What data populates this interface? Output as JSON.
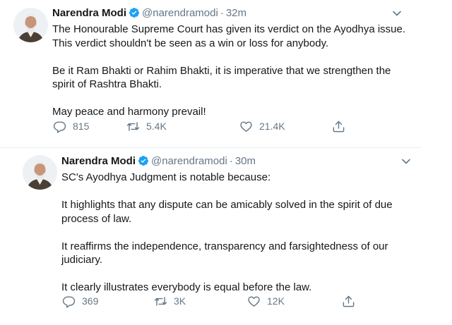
{
  "tweets": [
    {
      "author_name": "Narendra Modi",
      "handle": "@narendramodi",
      "separator": "·",
      "time": "32m",
      "paragraphs": [
        "The Honourable Supreme Court has given its verdict on the Ayodhya issue.\nThis verdict shouldn't be seen as a win or loss for anybody.",
        "Be it Ram Bhakti or Rahim Bhakti, it is imperative that we strengthen the\nspirit of Rashtra Bhakti.",
        "May peace and harmony prevail!"
      ],
      "replies": "815",
      "retweets": "5.4K",
      "likes": "21.4K"
    },
    {
      "author_name": "Narendra Modi",
      "handle": "@narendramodi",
      "separator": "·",
      "time": "30m",
      "paragraphs": [
        "SC's Ayodhya Judgment is notable because:",
        "It highlights that any dispute can be amicably solved in the spirit of due\nprocess of law.",
        "It reaffirms the independence, transparency and farsightedness of our\njudiciary.",
        "It clearly illustrates everybody is equal before the law."
      ],
      "replies": "369",
      "retweets": "3K",
      "likes": "12K"
    }
  ],
  "icons": {
    "verified": "verified-badge-icon",
    "caret": "chevron-down-icon",
    "reply": "reply-icon",
    "retweet": "retweet-icon",
    "like": "heart-icon",
    "share": "share-icon"
  },
  "colors": {
    "text": "#14171a",
    "secondary": "#657786",
    "verified": "#1da1f2",
    "divider": "#e6ecf0"
  }
}
